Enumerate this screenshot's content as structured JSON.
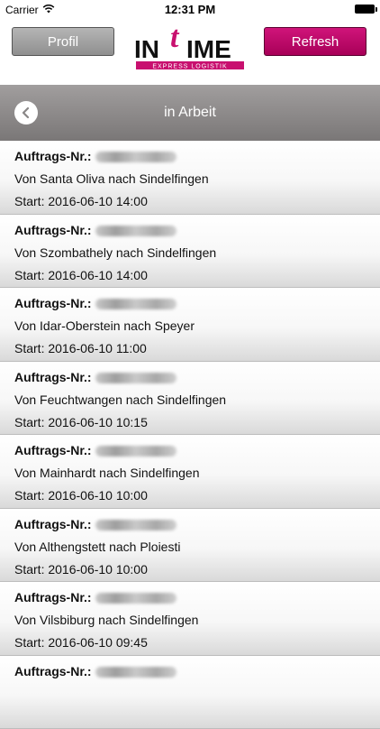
{
  "status_bar": {
    "carrier": "Carrier",
    "time": "12:31 PM"
  },
  "header": {
    "profil_label": "Profil",
    "refresh_label": "Refresh",
    "logo": {
      "main": "INTIME",
      "tagline": "EXPRESS LOGISTIK"
    },
    "brand_color": "#c8106f"
  },
  "nav": {
    "title": "in Arbeit"
  },
  "orders": [
    {
      "label": "Auftrags-Nr.:",
      "route": "Von Santa Oliva nach Sindelfingen",
      "start": "Start: 2016-06-10 14:00"
    },
    {
      "label": "Auftrags-Nr.:",
      "route": "Von Szombathely nach Sindelfingen",
      "start": "Start: 2016-06-10 14:00"
    },
    {
      "label": "Auftrags-Nr.:",
      "route": "Von Idar-Oberstein nach Speyer",
      "start": "Start: 2016-06-10 11:00"
    },
    {
      "label": "Auftrags-Nr.:",
      "route": "Von Feuchtwangen nach Sindelfingen",
      "start": "Start: 2016-06-10 10:15"
    },
    {
      "label": "Auftrags-Nr.:",
      "route": "Von Mainhardt nach Sindelfingen",
      "start": "Start: 2016-06-10 10:00"
    },
    {
      "label": "Auftrags-Nr.:",
      "route": "Von Althengstett nach Ploiesti",
      "start": "Start: 2016-06-10 10:00"
    },
    {
      "label": "Auftrags-Nr.:",
      "route": "Von Vilsbiburg nach Sindelfingen",
      "start": "Start: 2016-06-10 09:45"
    },
    {
      "label": "Auftrags-Nr.:",
      "route": "",
      "start": ""
    }
  ]
}
